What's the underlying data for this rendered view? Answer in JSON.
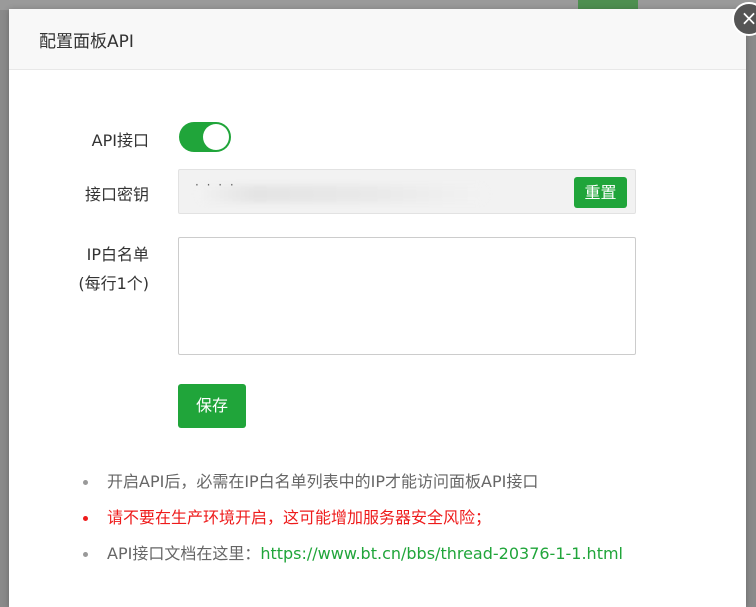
{
  "modal": {
    "title": "配置面板API",
    "close_icon": "×"
  },
  "form": {
    "api_label": "API接口",
    "api_enabled": true,
    "key_label": "接口密钥",
    "key_value": "· · · ·",
    "reset_label": "重置",
    "whitelist_label": "IP白名单",
    "whitelist_hint": "(每行1个)",
    "whitelist_value": "",
    "save_label": "保存"
  },
  "notes": {
    "note1": "开启API后，必需在IP白名单列表中的IP才能访问面板API接口",
    "note2": "请不要在生产环境开启，这可能增加服务器安全风险；",
    "note3_prefix": "API接口文档在这里：",
    "note3_link": "https://www.bt.cn/bbs/thread-20376-1-1.html"
  },
  "colors": {
    "accent": "#20a53a",
    "warning": "#ee1b1b",
    "overlay": "#8a8a8a"
  }
}
